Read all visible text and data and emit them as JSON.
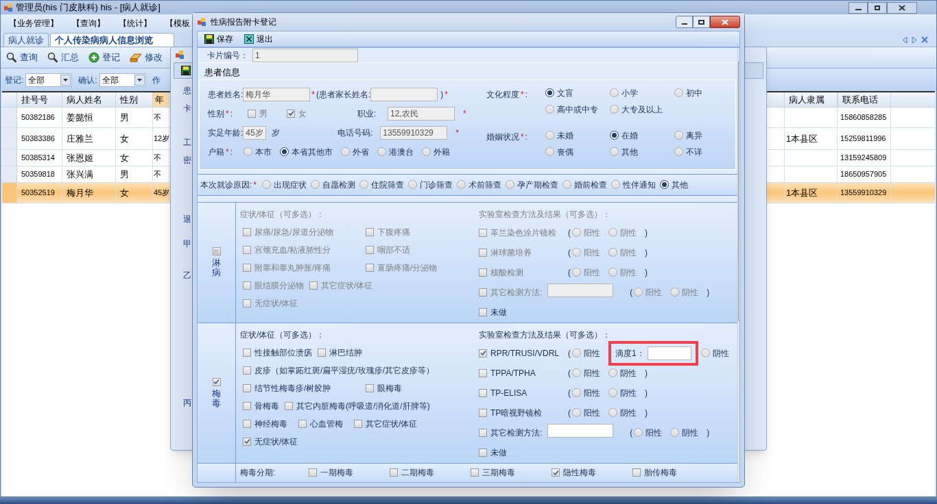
{
  "main_window": {
    "title": "管理员(his 门皮肤科) his - [病人就诊]",
    "menu": [
      "【业务管理】",
      "【查询】",
      "【统计】",
      "【模板"
    ]
  },
  "tabs": [
    {
      "label": "病人就诊",
      "selected": false
    },
    {
      "label": "个人传染病病人信息浏览",
      "selected": true
    }
  ],
  "toolbar": [
    {
      "kind": "search",
      "label": "查询"
    },
    {
      "kind": "search",
      "label": "汇总"
    },
    {
      "kind": "add",
      "label": "登记"
    },
    {
      "kind": "eraser",
      "label": "修改"
    },
    {
      "kind": "filter"
    }
  ],
  "filters": [
    {
      "label": "登记:",
      "value": "全部"
    },
    {
      "label": "确认:",
      "value": "全部"
    },
    {
      "label": "作"
    }
  ],
  "table": {
    "columns": [
      "挂号号",
      "病人姓名",
      "性别",
      "年"
    ],
    "right_columns": [
      "病人隶属",
      "联系电话"
    ],
    "rows": [
      {
        "cells": [
          "50382186",
          "姜懿恒",
          "男",
          "不"
        ],
        "phone": "15860858285",
        "selected": false
      },
      {
        "cells": [
          "50383386",
          "庄雅兰",
          "女",
          "12岁"
        ],
        "affiliation": "1本县区",
        "phone": "15259811996",
        "selected": false
      },
      {
        "cells": [
          "50385314",
          "张恩姬",
          "女",
          "不"
        ],
        "phone": "13159245809",
        "selected": false
      },
      {
        "cells": [
          "50359818",
          "张兴满",
          "男",
          "不"
        ],
        "phone": "18650957905",
        "selected": false
      },
      {
        "cells": [
          "50352519",
          "梅月华",
          "女",
          "45岁"
        ],
        "affiliation": "1本县区",
        "phone": "13559910329",
        "selected": true
      }
    ]
  },
  "middle_window": {
    "labels": [
      "患",
      "卡",
      "工",
      "密",
      "退",
      "甲",
      "乙",
      "丙"
    ]
  },
  "dialog": {
    "title": "性病报告附卡登记",
    "toolbar": [
      {
        "kind": "save",
        "label": "保存"
      },
      {
        "kind": "exit",
        "label": "退出"
      }
    ],
    "card_no": {
      "label": "卡片编号：",
      "value": "1"
    },
    "patient": {
      "title": "患者信息",
      "name": {
        "label": "患者姓名:",
        "value": "梅月华",
        "mark": "*"
      },
      "parent": {
        "label": "(患者家长姓名:",
        "close": ")",
        "mark": "*"
      },
      "gender": {
        "label": "性别",
        "mark": "*",
        "colon": ":",
        "options": [
          {
            "label": "男",
            "checked": false
          },
          {
            "label": "女",
            "checked": true
          }
        ]
      },
      "occupation": {
        "label": "职业:",
        "value": "12,农民",
        "mark": "*"
      },
      "age": {
        "label": "实足年龄:",
        "value": "45岁",
        "unit": "岁"
      },
      "phone": {
        "label": "电话号码:",
        "value": "13559910329",
        "mark": "*"
      },
      "residence": {
        "label": "户籍",
        "mark": "*",
        "colon": ":",
        "options": [
          {
            "label": "本市",
            "selected": false
          },
          {
            "label": "本省其他市",
            "selected": true
          },
          {
            "label": "外省",
            "selected": false
          },
          {
            "label": "港澳台",
            "selected": false
          },
          {
            "label": "外籍",
            "selected": false
          }
        ]
      },
      "education": {
        "label": "文化程度",
        "mark": "*",
        "colon": ":",
        "options": [
          {
            "label": "文盲",
            "selected": true
          },
          {
            "label": "小学",
            "selected": false
          },
          {
            "label": "初中",
            "selected": false
          },
          {
            "label": "高中或中专",
            "selected": false
          },
          {
            "label": "大专及以上",
            "selected": false
          }
        ]
      },
      "marriage": {
        "label": "婚姻状况",
        "mark": "*",
        "colon": ":",
        "options": [
          {
            "label": "未婚",
            "selected": false
          },
          {
            "label": "在婚",
            "selected": true
          },
          {
            "label": "离异",
            "selected": false
          },
          {
            "label": "丧偶",
            "selected": false
          },
          {
            "label": "其他",
            "selected": false
          },
          {
            "label": "不详",
            "selected": false
          }
        ]
      }
    },
    "visit_reason": {
      "label": "本次就诊原因:",
      "mark": "*",
      "options": [
        {
          "label": "出现症状",
          "selected": false
        },
        {
          "label": "自愿检测",
          "selected": false
        },
        {
          "label": "住院筛查",
          "selected": false
        },
        {
          "label": "门诊筛查",
          "selected": false
        },
        {
          "label": "术前筛查",
          "selected": false
        },
        {
          "label": "孕产期检查",
          "selected": false
        },
        {
          "label": "婚前检查",
          "selected": false
        },
        {
          "label": "性伴通知",
          "selected": false
        },
        {
          "label": "其他",
          "selected": true
        }
      ]
    },
    "diseases": [
      {
        "name": "淋病",
        "checked": false,
        "symptoms_title": "症状/体征（可多选）：",
        "symptoms": [
          [
            {
              "label": "尿痛/尿急/尿道分泌物",
              "checked": false
            },
            {
              "label": "下腹疼痛",
              "checked": false
            }
          ],
          [
            {
              "label": "宫颈充血/粘液脓性分",
              "checked": false
            },
            {
              "label": "咽部不适",
              "checked": false
            }
          ],
          [
            {
              "label": "附睾和睾丸肿胀/疼痛",
              "checked": false
            },
            {
              "label": "直肠疼痛/分泌物",
              "checked": false
            }
          ],
          [
            {
              "label": "眼结膜分泌物",
              "checked": false
            },
            {
              "label": "其它症状/体征",
              "checked": false
            }
          ],
          [
            {
              "label": "无症状/体征",
              "checked": false
            }
          ]
        ],
        "lab_title": "实验室检查方法及结果（可多选）：",
        "labs": [
          {
            "kind": "result",
            "label": "革兰染色涂片镜检",
            "checked": false,
            "open": "(",
            "options": [
              {
                "label": "阳性",
                "selected": false
              },
              {
                "label": "阴性",
                "selected": false
              }
            ],
            "close": ")"
          },
          {
            "kind": "result",
            "label": "淋球菌培养",
            "checked": false,
            "open": "(",
            "options": [
              {
                "label": "阳性",
                "selected": false
              },
              {
                "label": "阴性",
                "selected": false
              }
            ],
            "close": ")"
          },
          {
            "kind": "result",
            "label": "核酸检测",
            "checked": false,
            "open": "(",
            "options": [
              {
                "label": "阳性",
                "selected": false
              },
              {
                "label": "阴性",
                "selected": false
              }
            ],
            "close": ")"
          },
          {
            "kind": "other",
            "label": "其它检测方法:",
            "checked": false,
            "open": "(",
            "options": [
              {
                "label": "阳性",
                "selected": false
              },
              {
                "label": "阴性",
                "selected": false
              }
            ],
            "close": ")"
          },
          {
            "kind": "plain",
            "label": "未做",
            "checked": false
          }
        ]
      },
      {
        "name": "梅毒",
        "checked": true,
        "symptoms_title": "症状/体征（可多选）：",
        "symptoms": [
          [
            {
              "label": "性接触部位溃疡",
              "checked": false
            },
            {
              "label": "淋巴结肿",
              "checked": false
            }
          ],
          [
            {
              "label": "皮疹（如掌跖红斑/扁平湿疣/玫瑰疹/其它皮疹等）",
              "checked": false
            }
          ],
          [
            {
              "label": "结节性梅毒疹/树胶肿",
              "checked": false
            },
            {
              "label": "眼梅毒",
              "checked": false
            }
          ],
          [
            {
              "label": "骨梅毒",
              "checked": false
            },
            {
              "label": "其它内脏梅毒(呼吸道/消化道/肝脾等)",
              "checked": false
            }
          ],
          [
            {
              "label": "神经梅毒",
              "checked": false
            },
            {
              "label": "心血管梅",
              "checked": false
            },
            {
              "label": "其它症状/体征",
              "checked": false
            }
          ],
          [
            {
              "label": "无症状/体征",
              "checked": true
            }
          ]
        ],
        "lab_title": "实验室检查方法及结果（可多选）：",
        "labs": [
          {
            "kind": "result",
            "label": "RPR/TRUSI/VDRL",
            "checked": true,
            "open": "(",
            "options": [
              {
                "label": "阳性",
                "selected": false
              },
              {
                "label": "阴性",
                "selected": false
              }
            ],
            "titer": "滴度1："
          },
          {
            "kind": "result",
            "label": "TPPA/TPHA",
            "checked": false,
            "open": "(",
            "options": [
              {
                "label": "阳性",
                "selected": false
              },
              {
                "label": "阴性",
                "selected": false
              }
            ],
            "close": ")"
          },
          {
            "kind": "result",
            "label": "TP-ELISA",
            "checked": false,
            "open": "(",
            "options": [
              {
                "label": "阳性",
                "selected": false
              },
              {
                "label": "阴性",
                "selected": false
              }
            ],
            "close": ")"
          },
          {
            "kind": "result",
            "label": "TP暗视野镜检",
            "checked": false,
            "open": "(",
            "options": [
              {
                "label": "阳性",
                "selected": false
              },
              {
                "label": "阴性",
                "selected": false
              }
            ],
            "close": ")"
          },
          {
            "kind": "other",
            "label": "其它检测方法:",
            "checked": false,
            "open": "(",
            "options": [
              {
                "label": "阳性",
                "selected": false
              },
              {
                "label": "阴性",
                "selected": false
              }
            ],
            "close": ")"
          },
          {
            "kind": "plain",
            "label": "未做",
            "checked": false
          }
        ]
      }
    ],
    "staging": {
      "label": "梅毒分期:",
      "options": [
        {
          "label": "一期梅毒",
          "checked": false
        },
        {
          "label": "二期梅毒",
          "checked": false
        },
        {
          "label": "三期梅毒",
          "checked": false
        },
        {
          "label": "隐性梅毒",
          "checked": true
        },
        {
          "label": "胎传梅毒",
          "checked": false
        }
      ]
    }
  }
}
